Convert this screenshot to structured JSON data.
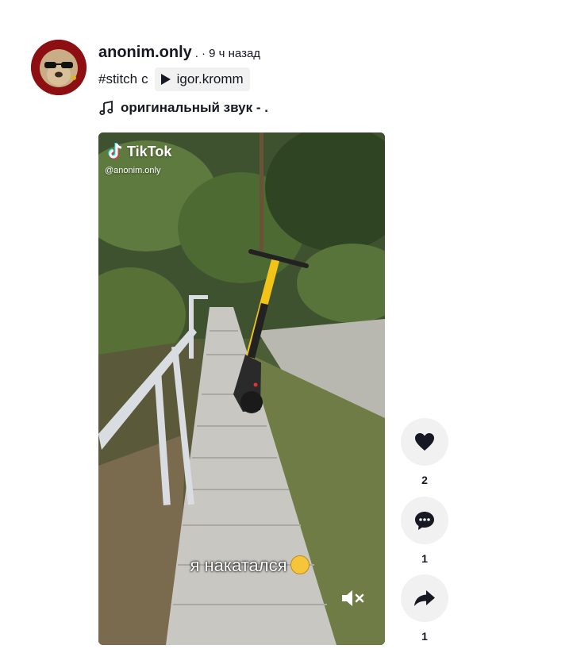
{
  "post": {
    "username": "anonim.only",
    "separator": ".",
    "time": "· 9 ч назад",
    "hashtag": "#stitch",
    "with_text": "с",
    "stitch_user": "igor.kromm",
    "sound": "оригинальный звук - ."
  },
  "video": {
    "watermark_brand": "TikTok",
    "watermark_handle": "@anonim.only",
    "subtitle": "я накатался"
  },
  "actions": {
    "likes": "2",
    "comments": "1",
    "shares": "1"
  },
  "colors": {
    "text": "#161823",
    "action_bg": "#f1f1f2",
    "avatar_ring": "#8e0f12",
    "scooter_yellow": "#f2c418"
  },
  "icons": [
    "music-icon",
    "play-icon",
    "heart-icon",
    "comment-icon",
    "share-icon",
    "mute-icon",
    "tiktok-logo-icon"
  ]
}
